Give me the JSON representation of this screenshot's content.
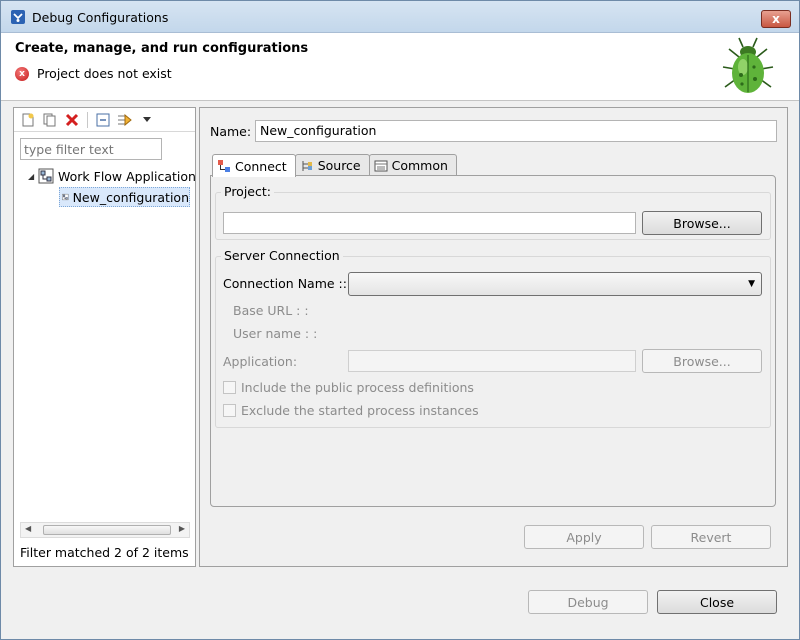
{
  "window": {
    "title": "Debug Configurations",
    "close_glyph": "x",
    "icon": "debug-dialog-icon"
  },
  "header": {
    "title": "Create, manage, and run configurations",
    "message": "Project does not exist",
    "error_glyph": "x",
    "image": "bug-icon"
  },
  "left": {
    "toolbar": [
      "new-config-icon",
      "duplicate-icon",
      "delete-icon",
      "collapse-all-icon",
      "filter-icon",
      "view-menu-icon"
    ],
    "filter_placeholder": "type filter text",
    "tree": [
      {
        "label": "Work Flow Application",
        "expanded": true
      },
      {
        "label": "New_configuration",
        "selected": true
      }
    ],
    "status": "Filter matched 2 of 2 items"
  },
  "right": {
    "name_label": "Name:",
    "name_value": "New_configuration",
    "tabs": [
      {
        "label": "Connect",
        "icon": "connect-icon",
        "active": true
      },
      {
        "label": "Source",
        "icon": "source-icon"
      },
      {
        "label": "Common",
        "icon": "common-icon"
      }
    ],
    "project": {
      "title": "Project:",
      "value": "",
      "browse": "Browse..."
    },
    "server": {
      "title": "Server Connection",
      "connection_label": "Connection Name ::",
      "connection_value": "",
      "base_url_label": "Base URL : :",
      "user_name_label": "User name : :",
      "application_label": "Application:",
      "application_value": "",
      "browse": "Browse...",
      "include_label": "Include the public process definitions",
      "exclude_label": "Exclude the started process instances"
    },
    "apply": "Apply",
    "revert": "Revert"
  },
  "footer": {
    "debug": "Debug",
    "close": "Close"
  },
  "colors": {
    "titlebar": "#c3d7eb",
    "selection": "#d9e8fb",
    "error": "#c41a1a"
  }
}
